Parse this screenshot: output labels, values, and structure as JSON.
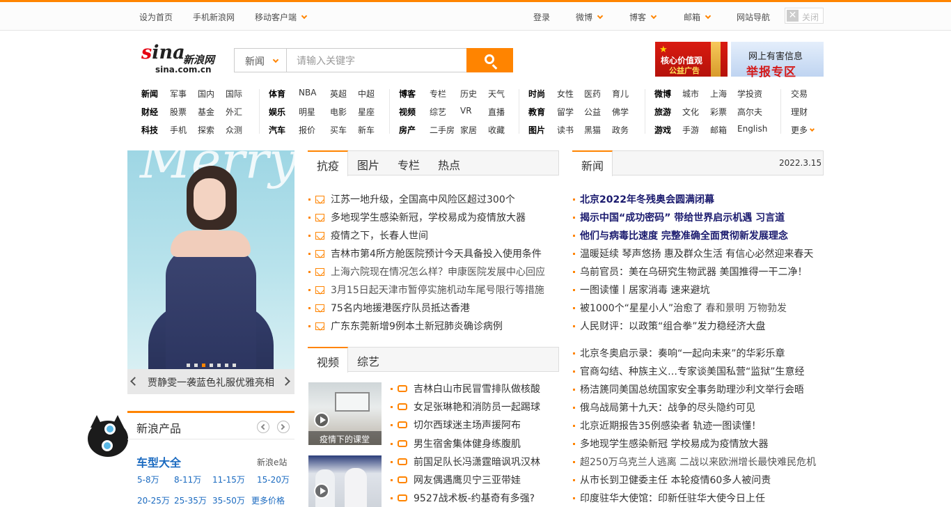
{
  "topbar": {
    "set_home": "设为首页",
    "mobile_sina": "手机新浪网",
    "mobile_client": "移动客户端",
    "login": "登录",
    "weibo": "微博",
    "blog": "博客",
    "mail": "邮箱",
    "site_nav": "网站导航",
    "close": "关闭"
  },
  "logo": {
    "mark_red": "s",
    "mark_rest": "ina",
    "cn": "新浪网",
    "domain": "sina.com.cn"
  },
  "search": {
    "scope": "新闻",
    "placeholder": "请输入关键字"
  },
  "ads": {
    "ad1_line1": "核心价值观",
    "ad1_line2": "公益广告",
    "ad2_line1": "网上有害信息",
    "ad2_line2": "举报专区"
  },
  "nav": {
    "group1": [
      [
        "新闻",
        "军事",
        "国内",
        "国际"
      ],
      [
        "财经",
        "股票",
        "基金",
        "外汇"
      ],
      [
        "科技",
        "手机",
        "探索",
        "众测"
      ]
    ],
    "group2": [
      [
        "体育",
        "NBA",
        "英超",
        "中超"
      ],
      [
        "娱乐",
        "明星",
        "电影",
        "星座"
      ],
      [
        "汽车",
        "报价",
        "买车",
        "新车"
      ]
    ],
    "group3": [
      [
        "博客",
        "专栏",
        "历史",
        "天气"
      ],
      [
        "视频",
        "综艺",
        "VR",
        "直播"
      ],
      [
        "房产",
        "二手房",
        "家居",
        "收藏"
      ]
    ],
    "group4": [
      [
        "时尚",
        "女性",
        "医药",
        "育儿"
      ],
      [
        "教育",
        "留学",
        "公益",
        "佛学"
      ],
      [
        "图片",
        "读书",
        "黑猫",
        "政务"
      ]
    ],
    "group5": [
      [
        "微博",
        "城市",
        "上海",
        "学投资"
      ],
      [
        "旅游",
        "文化",
        "彩票",
        "高尔夫"
      ],
      [
        "游戏",
        "手游",
        "邮箱",
        "English"
      ]
    ],
    "group6": [
      "交易",
      "理财",
      "更多"
    ]
  },
  "slideshow": {
    "caption": "贾静雯一袭蓝色礼服优雅亮相",
    "script_text": "Merry",
    "dot_count": 7,
    "active_dot": 3
  },
  "products": {
    "title": "新浪产品",
    "car_title": "车型大全",
    "ecar": "新浪e站",
    "prices_row1": [
      "5-8万",
      "8-11万",
      "11-15万",
      "15-20万"
    ],
    "prices_row2": [
      "20-25万",
      "25-35万",
      "35-50万",
      "更多价格"
    ]
  },
  "center": {
    "tabs": [
      "抗疫",
      "图片",
      "专栏",
      "热点"
    ],
    "news": [
      "江苏一地升级，全国高中风险区超过300个",
      "多地现学生感染新冠，学校易成为疫情放大器",
      "疫情之下，长春人世间",
      "吉林市第4所方舱医院预计今天具备投入使用条件",
      "上海六院现在情况怎么样？申康医院发展中心回应",
      "3月15日起天津市暂停实施机动车尾号限行等措施",
      "75名内地援港医疗队员抵达香港",
      "广东东莞新增9例本土新冠肺炎确诊病例"
    ],
    "video_tabs": [
      "视频",
      "综艺"
    ],
    "thumb1_caption": "疫情下的课堂",
    "videos": [
      "吉林白山市民冒雪排队做核酸",
      "女足张琳艳和消防员一起踢球",
      "切尔西球迷主场声援阿布",
      "男生宿舍集体健身练腹肌",
      "前国足队长冯潇霆暗讽巩汉林",
      "网友偶遇鹰贝宁三亚带娃",
      "9527战术板-约基奇有多强?"
    ]
  },
  "right": {
    "tab": "新闻",
    "date": "2022.3.15",
    "headlines": [
      "北京2022年冬残奥会圆满闭幕",
      "揭示中国“成功密码” 带给世界启示机遇 习言道",
      "他们与病毒比速度 完整准确全面贯彻新发展理念"
    ],
    "news1": [
      {
        "a": "温暖延续 琴声悠扬 惠及群众生活 有信心必然迎来春天",
        "b": ""
      },
      {
        "a": "乌前官员：美在乌研究生物武器 美国推得一干二净！",
        "b": ""
      },
      {
        "a": "一图读懂丨居家消毒 速来避坑",
        "b": ""
      },
      {
        "a": "被1000个“星星小人”治愈了 ",
        "b": "春和景明 万物勃发"
      },
      {
        "a": "人民财评：以政策“组合拳”发力稳经济大盘",
        "b": ""
      }
    ],
    "news2": [
      "北京冬奥启示录：奏响“一起向未来”的华彩乐章",
      "官商勾结、种族主义…专家谈美国私营“监狱”生意经",
      "杨洁篪同美国总统国家安全事务助理沙利文举行会晤",
      "俄乌战局第十九天：战争的尽头隐约可见",
      "北京近期报告35例感染者 轨迹一图读懂！",
      "多地现学生感染新冠 学校易成为疫情放大器",
      "超250万乌克兰人逃离 二战以来欧洲增长最快难民危机",
      "从市长到卫健委主任 本轮疫情60多人被问责",
      "印度驻华大使馆：印新任驻华大使今日上任"
    ]
  },
  "colors": {
    "accent": "#ff8400",
    "link_blue": "#1a6ac0",
    "headline": "#1a1a6e"
  }
}
